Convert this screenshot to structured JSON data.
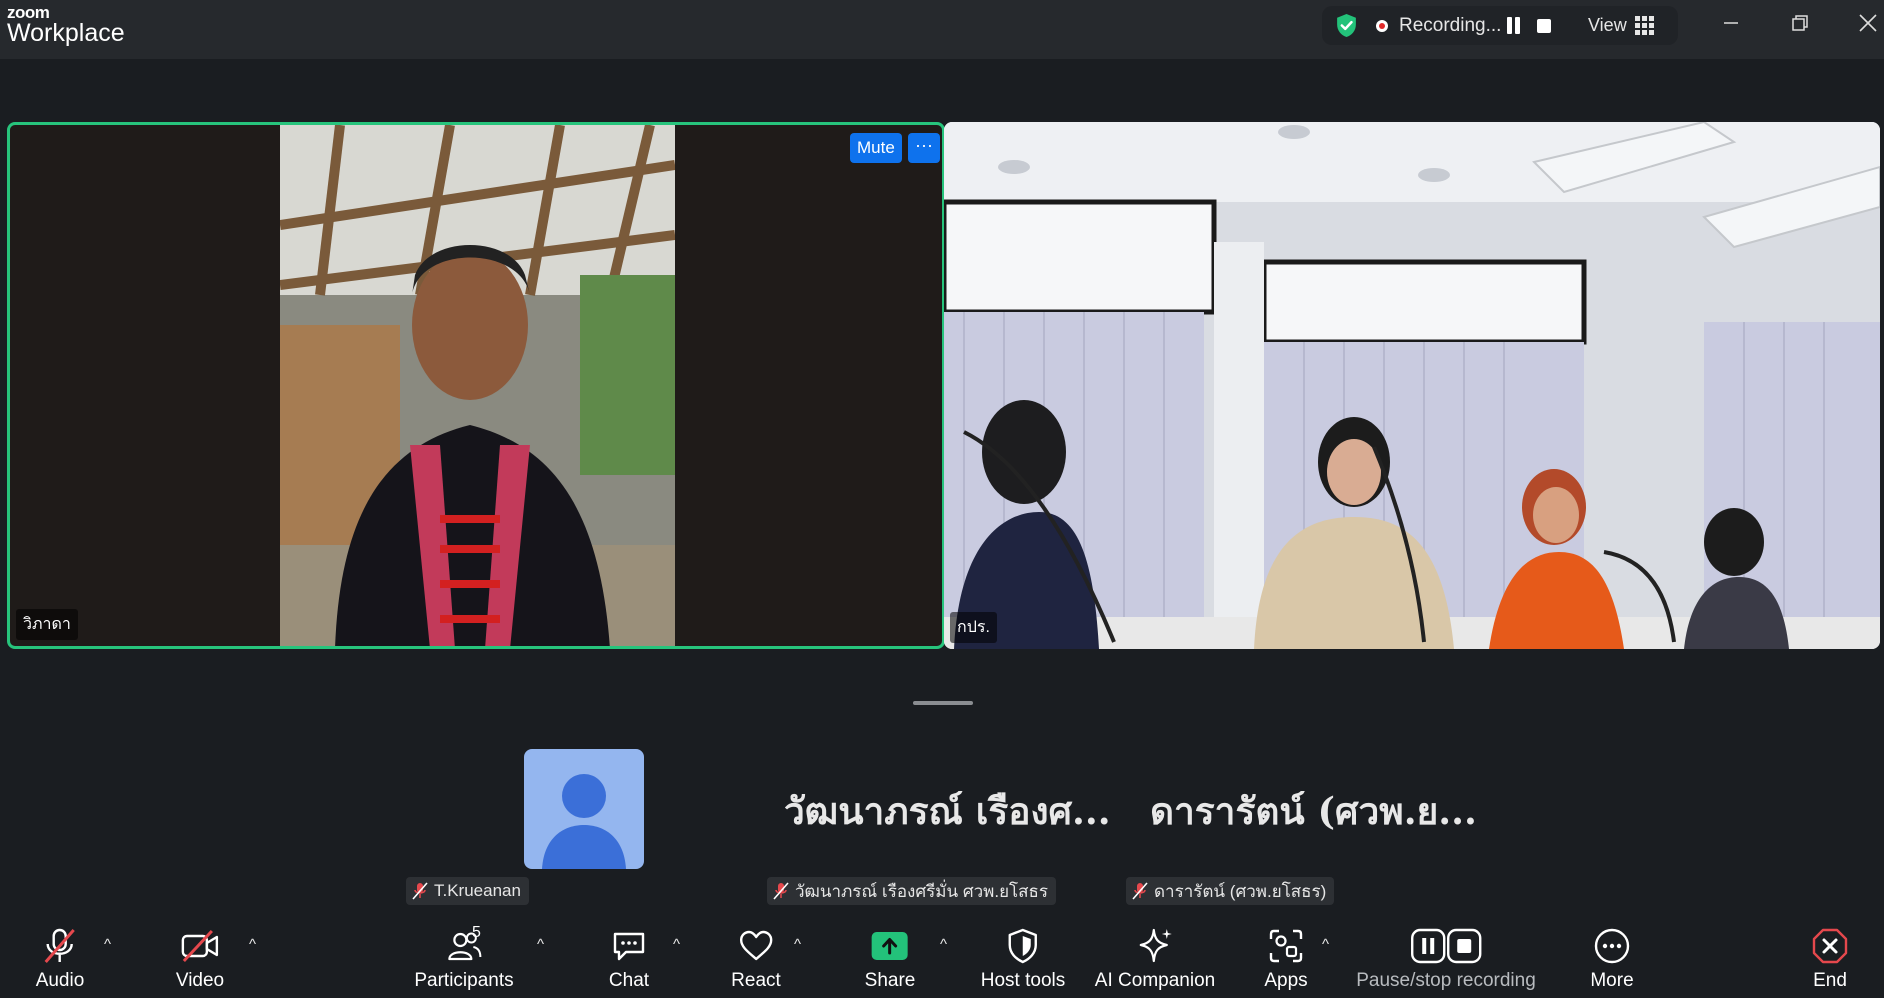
{
  "app": {
    "brand_top": "zoom",
    "brand_bottom": "Workplace"
  },
  "recording": {
    "status_text": "Recording...",
    "view_label": "View"
  },
  "tiles": [
    {
      "name": "วิภาดา",
      "mute_label": "Mute",
      "more_label": "···",
      "active_speaker": true
    },
    {
      "name": "กปร."
    }
  ],
  "thumbnails": [
    {
      "display": "",
      "label": "T.Krueanan"
    },
    {
      "display": "วัฒนาภรณ์  เรืองศ...",
      "label": "วัฒนาภรณ์  เรืองศรีมั่น ศวพ.ยโสธร"
    },
    {
      "display": "ดารารัตน์ (ศวพ.ย...",
      "label": "ดารารัตน์ (ศวพ.ยโสธร)"
    }
  ],
  "toolbar": {
    "audio": "Audio",
    "video": "Video",
    "participants": "Participants",
    "participants_count": "5",
    "chat": "Chat",
    "react": "React",
    "share": "Share",
    "host_tools": "Host tools",
    "ai_companion": "AI Companion",
    "apps": "Apps",
    "pause_stop": "Pause/stop recording",
    "more": "More",
    "end": "End"
  },
  "colors": {
    "accent_blue": "#0e72ed",
    "active_border": "#27c47c",
    "share_green": "#23c27a",
    "end_red": "#e5484d",
    "mic_off_red": "#e5484d"
  }
}
